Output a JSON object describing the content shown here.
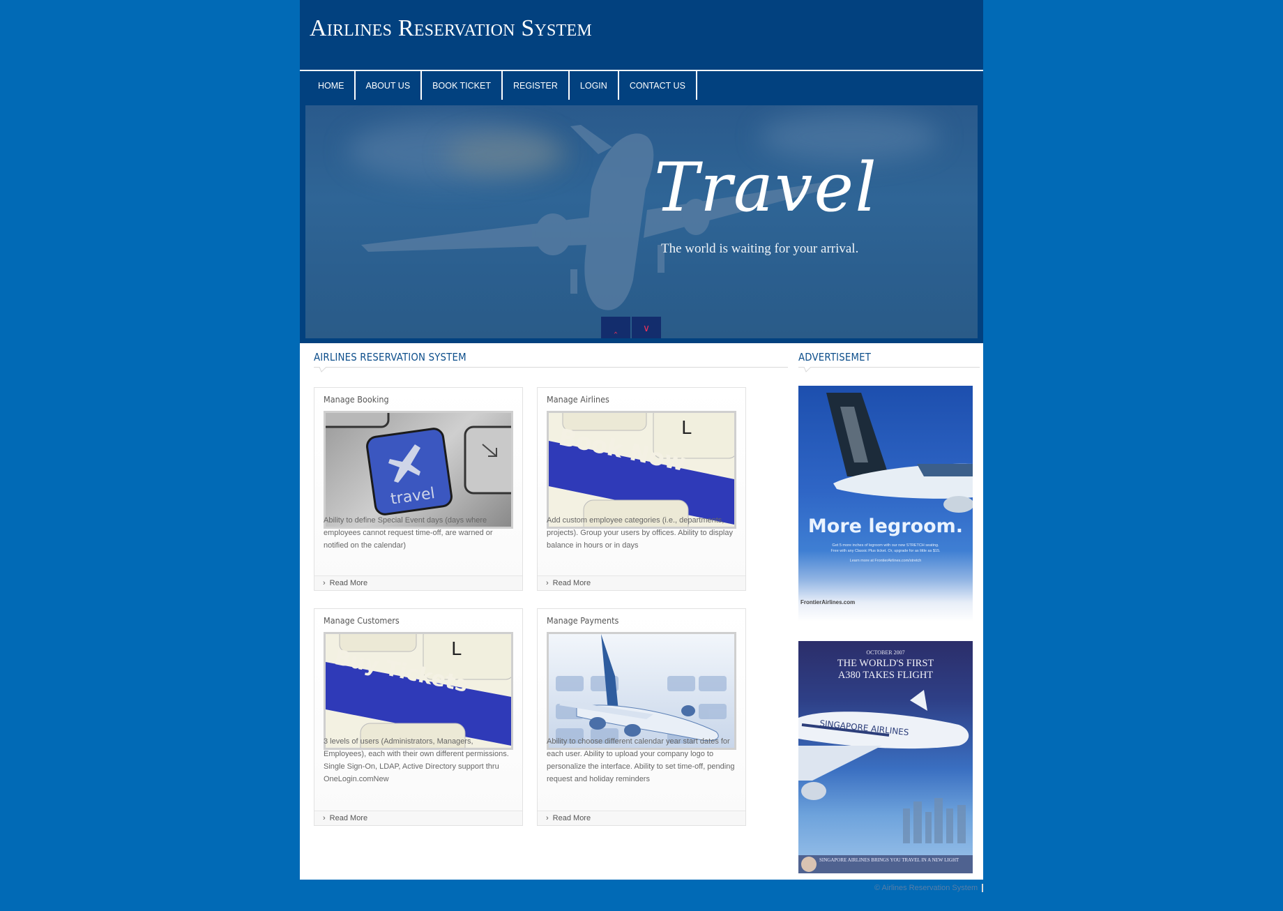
{
  "header": {
    "site_title": "Airlines Reservation System"
  },
  "nav": {
    "items": [
      {
        "label": "HOME"
      },
      {
        "label": "ABOUT US"
      },
      {
        "label": "BOOK TICKET"
      },
      {
        "label": "REGISTER"
      },
      {
        "label": "LOGIN"
      },
      {
        "label": "CONTACT US"
      }
    ]
  },
  "banner": {
    "script_title": "Travel",
    "tagline": "The world is waiting for your arrival.",
    "prev_icon": "chevron-up-icon",
    "next_icon": "chevron-down-icon"
  },
  "main": {
    "section_title": "AIRLINES RESERVATION SYSTEM",
    "read_more_label": "Read More",
    "cards": [
      {
        "title": "Manage Booking",
        "image": "travel-key-keyboard",
        "image_text": "travel",
        "text": "Ability to define Special Event days (days where employees cannot request time-off, are warned or notified on the calendar)"
      },
      {
        "title": "Manage Airlines",
        "image": "book-now-key-keyboard",
        "image_text": "Book Now",
        "text": "Add custom employee categories (i.e., departments, projects). Group your users by offices. Ability to display balance in hours or in days"
      },
      {
        "title": "Manage Customers",
        "image": "buy-tickets-key-keyboard",
        "image_text": "Buy Tickets",
        "text": "3 levels of users (Administrators, Managers, Employees), each with their own different permissions. Single Sign-On, LDAP, Active Directory support thru OneLogin.comNew"
      },
      {
        "title": "Manage Payments",
        "image": "airplane-on-keyboard",
        "text": "Ability to choose different calendar year start dates for each user. Ability to upload your company logo to personalize the interface. Ability to set time-off, pending request and holiday reminders"
      }
    ]
  },
  "sidebar": {
    "section_title": "ADVERTISEMET",
    "ads": [
      {
        "headline": "More legroom.",
        "body_line1": "Get 5 more inches of legroom with our new STRETCH seating.",
        "body_line2": "Free with any Classic Plus ticket. Or, upgrade for as little as $15.",
        "learn_more": "Learn more at FrontierAirlines.com/stretch",
        "brand": "FrontierAirlines.com"
      },
      {
        "date": "OCTOBER 2007",
        "headline_line1": "THE WORLD'S FIRST",
        "headline_line2": "A380 TAKES FLIGHT",
        "airline_livery": "SINGAPORE AIRLINES",
        "footer_line": "SINGAPORE AIRLINES BRINGS YOU TRAVEL IN A NEW LIGHT"
      }
    ]
  },
  "footer": {
    "copyright": "© Airlines Reservation System"
  },
  "colors": {
    "page_bg": "#016ab6",
    "header_bg": "#02417f",
    "accent_title": "#0c4e8b",
    "slider_btn": "#132d6d",
    "slider_arrow": "#e8325a"
  }
}
